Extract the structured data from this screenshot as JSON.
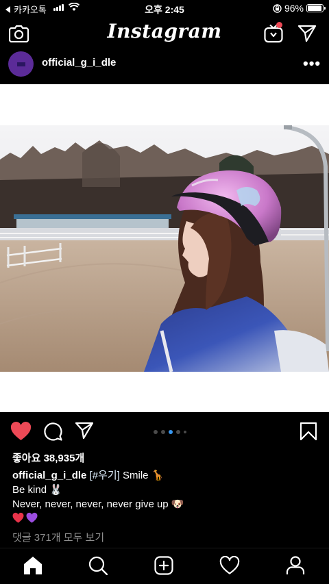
{
  "status_bar": {
    "back_app": "카카오톡",
    "time": "오후 2:45",
    "battery": "96%",
    "battery_level": 0.96
  },
  "header": {
    "logo": "Instagram",
    "icons": [
      "camera-icon",
      "igtv-icon",
      "direct-send-icon"
    ]
  },
  "post": {
    "username": "official_g_i_dle",
    "more": "•••",
    "carousel": {
      "count": 5,
      "active_index": 2
    },
    "likes": "좋아요 38,935개",
    "caption_user": "official_g_i_dle",
    "caption_tag": "[#우기]",
    "caption_line1_rest": "Smile 🦒",
    "caption_line2": "Be kind 🐰",
    "caption_line3": "Never, never, never, never give up 🐶",
    "caption_hearts": [
      "#e8334a",
      "#9b4de0"
    ],
    "view_comments": "댓글 371개 모두 보기",
    "liked": true
  },
  "colors": {
    "like_red": "#ed4956",
    "accent_blue": "#3897f0",
    "muted": "#8e8e8e"
  },
  "tab_bar": [
    "home-icon",
    "search-icon",
    "new-post-icon",
    "activity-icon",
    "profile-icon"
  ]
}
